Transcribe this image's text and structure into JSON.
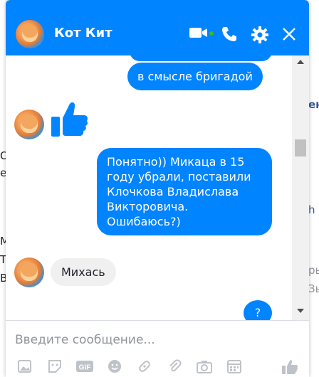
{
  "chat": {
    "title": "Кот Кит",
    "messages": [
      {
        "dir": "out",
        "text": ""
      },
      {
        "dir": "out",
        "text": "в смысле бригадой"
      },
      {
        "dir": "in",
        "type": "like"
      },
      {
        "dir": "out",
        "text": "Понятно)) Микаца в 15 году убрали, поставили Клочкова Владислава Викторовича. Ошибаюсь?)"
      },
      {
        "dir": "in",
        "text": "Михась"
      },
      {
        "dir": "out",
        "text": "?"
      }
    ],
    "composer": {
      "placeholder": "Введите сообщение..."
    },
    "toolbar": [
      "photo-icon",
      "sticker-icon",
      "gif-icon",
      "emoji-icon",
      "game-icon",
      "attachment-icon",
      "camera-icon",
      "calendar-icon",
      "like-icon"
    ]
  },
  "background": {
    "left_fragments": [
      "O",
      "el",
      "M",
      "T",
      "B"
    ],
    "right_fragments": [
      "ен",
      "h",
      "ры",
      "Зь"
    ]
  }
}
